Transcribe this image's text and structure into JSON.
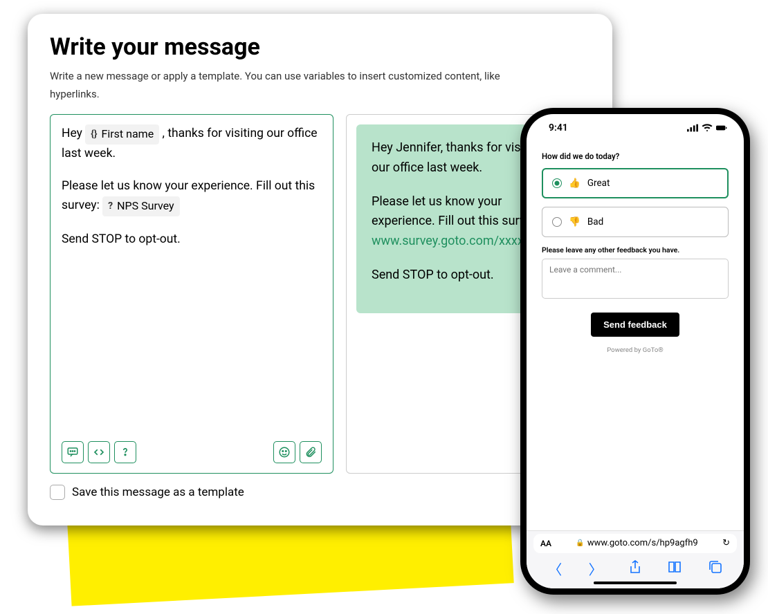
{
  "card": {
    "title": "Write your message",
    "subtitle": "Write a new message or apply a template. You can use variables to insert customized content, like hyperlinks."
  },
  "editor": {
    "line1_pre": "Hey ",
    "chip_var_label": "First name",
    "line1_post": " , thanks for visiting our office last week.",
    "line2a": "Please let us know your experience. Fill out this survey: ",
    "chip_survey_label": "NPS Survey",
    "line3": "Send STOP to opt-out."
  },
  "preview": {
    "p1": "Hey Jennifer, thanks for visiting our office last week.",
    "p2": "Please let us know your experience. Fill out this survey: ",
    "link": "www.survey.goto.com/xxxxx",
    "p3": "Send STOP to opt-out."
  },
  "save_label": "Save this message as a template",
  "phone": {
    "time": "9:41",
    "q1": "How did we do today?",
    "opt_great": "Great",
    "opt_bad": "Bad",
    "q2": "Please leave any other feedback you have.",
    "comment_placeholder": "Leave a comment...",
    "send": "Send feedback",
    "powered": "Powered by GoTo®",
    "url": "www.goto.com/s/hp9agfh9"
  }
}
